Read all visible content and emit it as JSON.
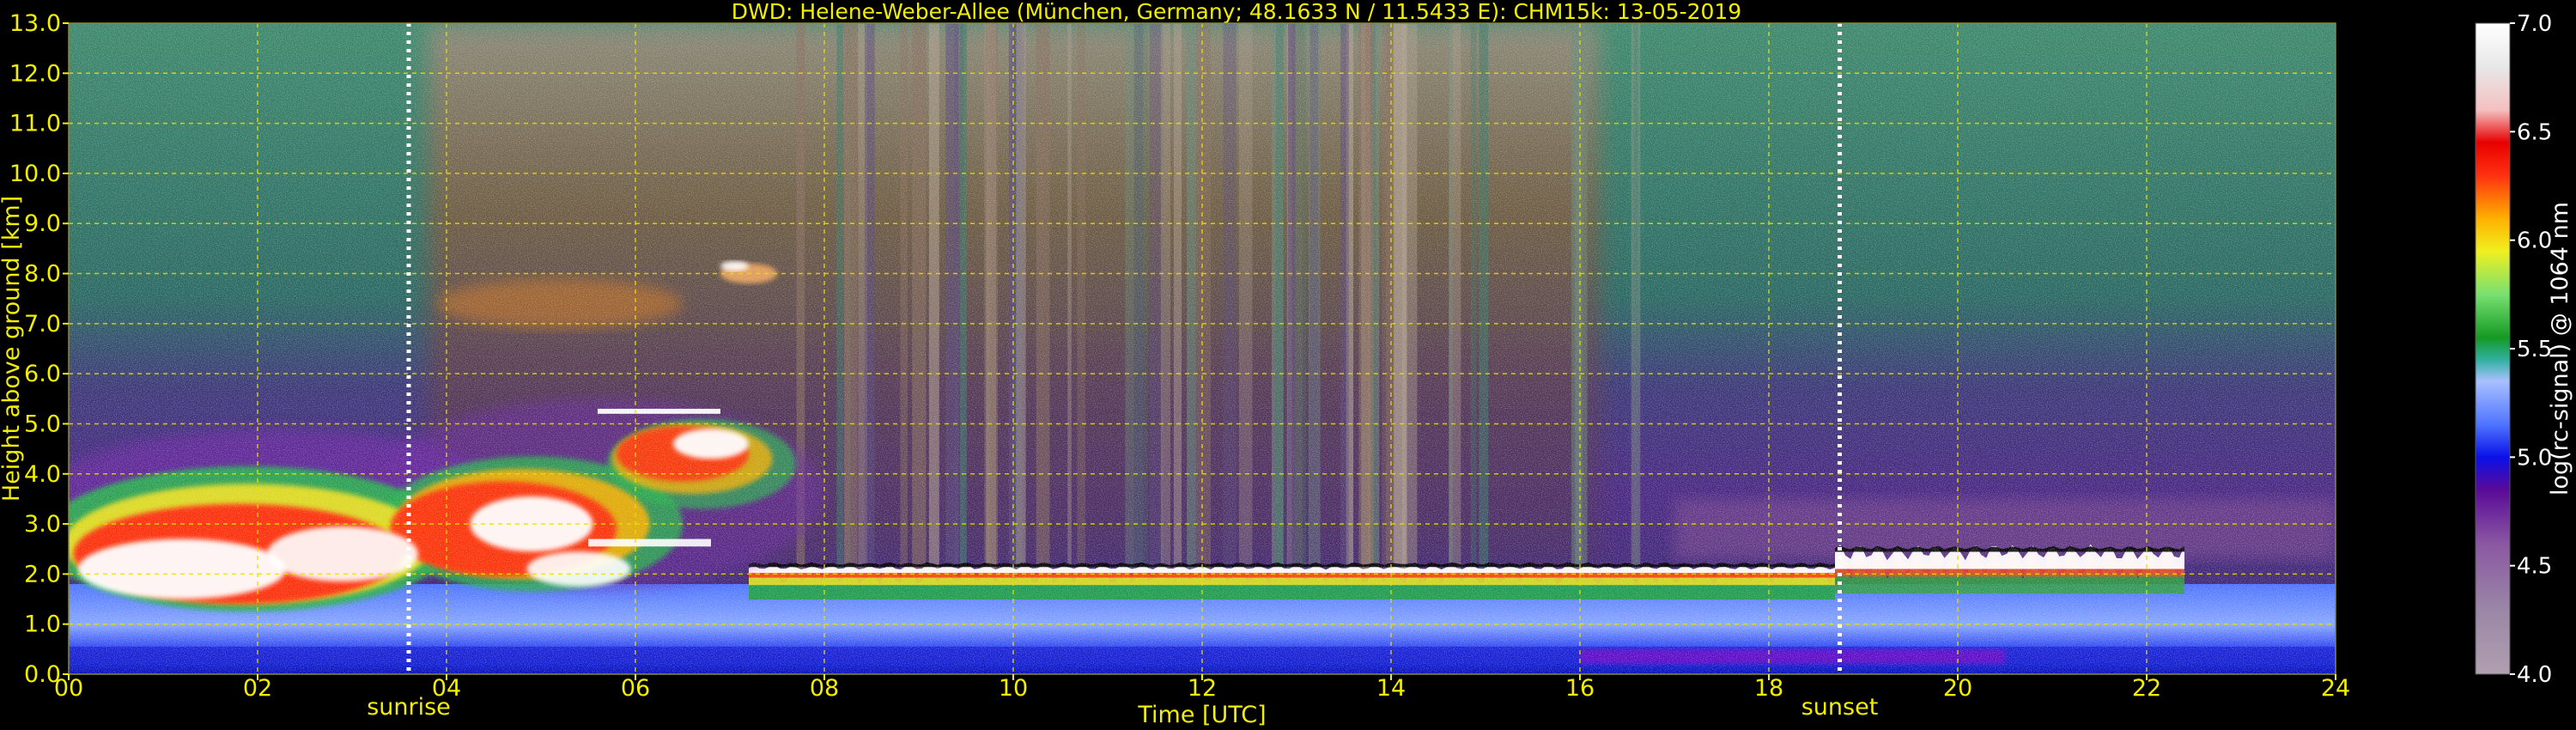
{
  "chart_data": {
    "type": "heatmap",
    "title": "DWD: Helene-Weber-Allee (München, Germany; 48.1633 N / 11.5433 E):    CHM15k: 13-05-2019",
    "xlabel": "Time [UTC]",
    "ylabel": "Height above ground [km]",
    "xlim": [
      0,
      24
    ],
    "ylim": [
      0,
      13
    ],
    "x_ticks": [
      0,
      2,
      4,
      6,
      8,
      10,
      12,
      14,
      16,
      18,
      20,
      22,
      24
    ],
    "x_tick_labels": [
      "00",
      "02",
      "04",
      "06",
      "08",
      "10",
      "12",
      "14",
      "16",
      "18",
      "20",
      "22",
      "24"
    ],
    "y_ticks": [
      0,
      1,
      2,
      3,
      4,
      5,
      6,
      7,
      8,
      9,
      10,
      11,
      12,
      13
    ],
    "y_tick_labels": [
      "0.0",
      "1.0",
      "2.0",
      "3.0",
      "4.0",
      "5.0",
      "6.0",
      "7.0",
      "8.0",
      "9.0",
      "10.0",
      "11.0",
      "12.0",
      "13.0"
    ],
    "grid": true,
    "grid_color": "#e8e000",
    "annotations": [
      {
        "label": "sunrise",
        "x": 3.6
      },
      {
        "label": "sunset",
        "x": 18.75
      }
    ],
    "colorbar": {
      "label": "log(rc-signal) @ 1064 nm",
      "range": [
        4.0,
        7.0
      ],
      "ticks": [
        4.0,
        4.5,
        5.0,
        5.5,
        6.0,
        6.5,
        7.0
      ],
      "tick_labels": [
        "4.0",
        "4.5",
        "5.0",
        "5.5",
        "6.0",
        "6.5",
        "7.0"
      ],
      "stops": [
        {
          "v": 4.0,
          "c": "#b0a0b0"
        },
        {
          "v": 4.3,
          "c": "#9a86a6"
        },
        {
          "v": 4.6,
          "c": "#8a58a2"
        },
        {
          "v": 4.85,
          "c": "#5a0a98"
        },
        {
          "v": 5.0,
          "c": "#0a10e8"
        },
        {
          "v": 5.15,
          "c": "#4e74ff"
        },
        {
          "v": 5.35,
          "c": "#a8c0ff"
        },
        {
          "v": 5.45,
          "c": "#30b0a0"
        },
        {
          "v": 5.55,
          "c": "#149a24"
        },
        {
          "v": 5.75,
          "c": "#78e070"
        },
        {
          "v": 5.95,
          "c": "#f0f020"
        },
        {
          "v": 6.1,
          "c": "#ffb000"
        },
        {
          "v": 6.3,
          "c": "#ff3010"
        },
        {
          "v": 6.45,
          "c": "#e80000"
        },
        {
          "v": 6.6,
          "c": "#f4c0c0"
        },
        {
          "v": 6.8,
          "c": "#e8e8e8"
        },
        {
          "v": 7.0,
          "c": "#ffffff"
        }
      ]
    },
    "regions": [
      {
        "name": "cloud layer (night)",
        "x": [
          0.0,
          3.6
        ],
        "y": [
          1.0,
          4.3
        ],
        "level": 7.0
      },
      {
        "name": "cloud layer (morning)",
        "x": [
          3.6,
          8.0
        ],
        "y": [
          1.5,
          5.3
        ],
        "level": 6.8
      },
      {
        "name": "cloud base layer (day)",
        "x": [
          7.0,
          18.7
        ],
        "y": [
          1.8,
          2.2
        ],
        "level": 6.7
      },
      {
        "name": "cloud base layer (evening)",
        "x": [
          18.7,
          22.5
        ],
        "y": [
          2.2,
          2.5
        ],
        "level": 7.0
      },
      {
        "name": "boundary layer",
        "x": [
          0.0,
          24.0
        ],
        "y": [
          0.0,
          2.0
        ],
        "level": 5.1
      }
    ],
    "colors": {
      "background": "#000000",
      "text": "#f2ee00",
      "boundary_layer": "#2e4cff",
      "cloud_top": "#ffffff",
      "clear_sky_high": "#3a7a66",
      "clear_sky_mid": "#5a3a8a"
    }
  }
}
